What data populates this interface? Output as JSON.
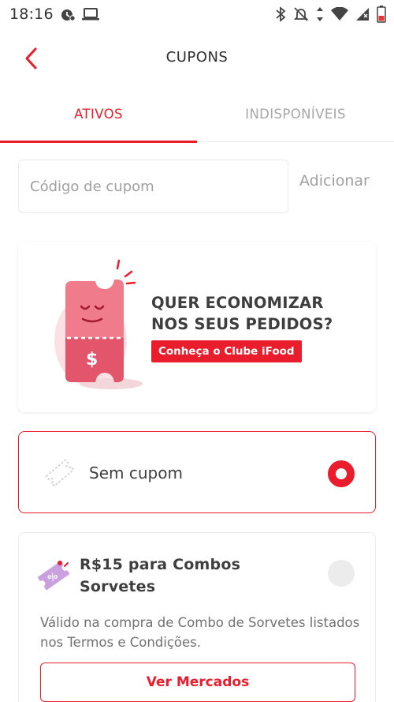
{
  "status_bar": {
    "time": "18:16",
    "left_icons": [
      "clock-alarm-icon",
      "laptop-icon"
    ],
    "right_icons": [
      "bluetooth-icon",
      "mute-icon",
      "data-arrows-icon",
      "wifi-icon",
      "signal-icon",
      "battery-icon"
    ]
  },
  "header": {
    "back_icon": "chevron-left-icon",
    "title": "CUPONS"
  },
  "tabs": [
    {
      "label": "ATIVOS",
      "active": true
    },
    {
      "label": "INDISPONÍVEIS",
      "active": false
    }
  ],
  "coupon_entry": {
    "placeholder": "Código de cupom",
    "value": "",
    "add_label": "Adicionar"
  },
  "promo_banner": {
    "title_line1": "QUER ECONOMIZAR",
    "title_line2": "NOS SEUS PEDIDOS?",
    "cta_label": "Conheça o Clube iFood",
    "illustration_icon": "smiling-ticket-icon"
  },
  "coupon_options": {
    "none": {
      "label": "Sem cupom",
      "icon": "ticket-outline-icon",
      "selected": true
    },
    "items": [
      {
        "title": "R$15 para Combos Sorvetes",
        "description": "Válido na compra de Combo de Sorvetes listados nos Termos e Condições.",
        "action_label": "Ver Mercados",
        "icon": "percent-ticket-icon",
        "selected": false
      }
    ]
  },
  "colors": {
    "brand_red": "#ea1d2c",
    "text_dark": "#3e3e3e",
    "text_muted": "#a0a0a0",
    "border": "#ececec"
  }
}
